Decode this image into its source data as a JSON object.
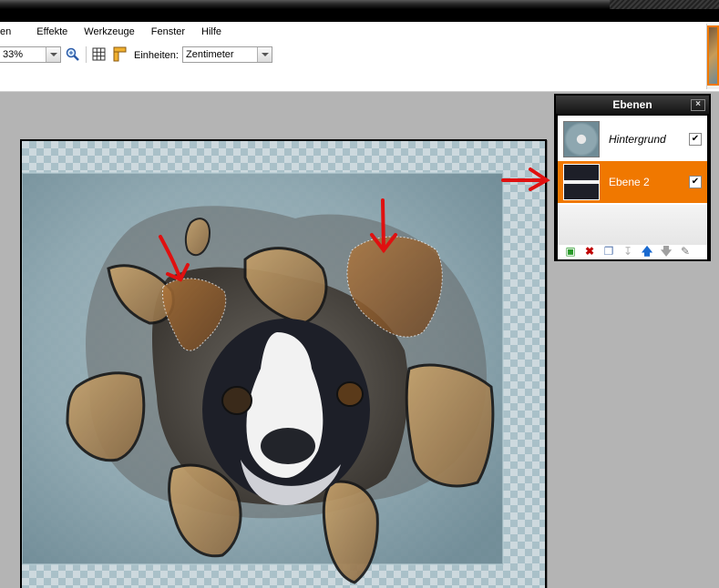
{
  "menu": {
    "items": [
      "en",
      "Effekte",
      "Werkzeuge",
      "Fenster",
      "Hilfe"
    ]
  },
  "toolbar": {
    "zoom_value": "33%",
    "units_label": "Einheiten:",
    "units_value": "Zentimeter"
  },
  "layers_panel": {
    "title": "Ebenen",
    "close_glyph": "×",
    "layers": [
      {
        "name": "Hintergrund",
        "visible": true,
        "selected": false
      },
      {
        "name": "Ebene 2",
        "visible": true,
        "selected": true
      }
    ],
    "check_glyph": "✔"
  },
  "colors": {
    "selection": "#f07800",
    "annotation_arrow": "#e01010"
  },
  "icons": [
    "zoom-icon",
    "grid-icon",
    "ruler-icon",
    "add-layer-icon",
    "delete-layer-icon",
    "duplicate-layer-icon",
    "merge-down-icon",
    "move-up-icon",
    "move-down-icon",
    "layer-properties-icon"
  ]
}
